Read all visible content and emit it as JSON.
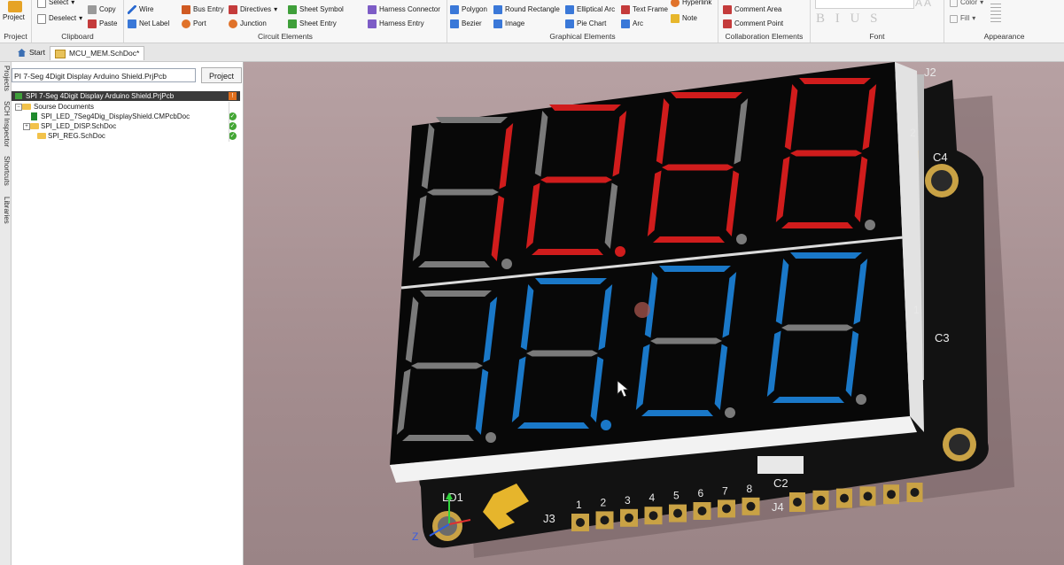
{
  "ribbon": {
    "project_group": {
      "button_label": "Project",
      "group_label": "Project"
    },
    "clipboard": {
      "select": "Select",
      "deselect": "Deselect",
      "copy": "Copy",
      "paste": "Paste",
      "group_label": "Clipboard"
    },
    "circuit": {
      "wire": "Wire",
      "net_label": "Net Label",
      "bus_entry": "Bus Entry",
      "port": "Port",
      "directives": "Directives",
      "junction": "Junction",
      "sheet_symbol": "Sheet Symbol",
      "sheet_entry": "Sheet Entry",
      "harness_connector": "Harness Connector",
      "harness_entry": "Harness Entry",
      "group_label": "Circuit Elements"
    },
    "graphical": {
      "polygon": "Polygon",
      "bezier": "Bezier",
      "round_rectangle": "Round Rectangle",
      "image": "Image",
      "elliptical_arc": "Elliptical Arc",
      "pie_chart": "Pie Chart",
      "text_frame": "Text Frame",
      "arc": "Arc",
      "hyperlink": "Hyperlink",
      "note": "Note",
      "group_label": "Graphical Elements"
    },
    "collaboration": {
      "comment_area": "Comment Area",
      "comment_point": "Comment Point",
      "group_label": "Collaboration Elements"
    },
    "font": {
      "styles": "B I U S",
      "group_label": "Font"
    },
    "appearance": {
      "color": "Color",
      "fill": "Fill",
      "group_label": "Appearance"
    }
  },
  "tabs": [
    {
      "label": "Start"
    },
    {
      "label": "MCU_MEM.SchDoc*"
    }
  ],
  "side_tabs": [
    "Projects",
    "SCH Inspector",
    "Shortcuts",
    "Libraries"
  ],
  "project_panel": {
    "search_value": "PI 7-Seg 4Digit Display Arduino Shield.PrjPcb",
    "project_button": "Project",
    "tree": [
      {
        "label": "SPI 7-Seg 4Digit Display Arduino Shield.PrjPcb"
      },
      {
        "label": "Sourse Documents"
      },
      {
        "label": "SPI_LED_7Seg4Dig_DisplayShield.CMPcbDoc"
      },
      {
        "label": "SPI_LED_DISP.SchDoc"
      },
      {
        "label": "SPI_REG.SchDoc"
      }
    ]
  },
  "board": {
    "labels": {
      "j2": "J2",
      "c4": "C4",
      "c3": "C3",
      "c2": "C2",
      "j3": "J3",
      "j4": "J4",
      "ld1": "LD1",
      "z": "Z",
      "pin_2": "2",
      "pin_1": "1"
    },
    "header_pins": [
      "1",
      "2",
      "3",
      "4",
      "5",
      "6",
      "7",
      "8"
    ],
    "top_color": "#d01c1c",
    "bottom_color": "#1a78c8"
  }
}
